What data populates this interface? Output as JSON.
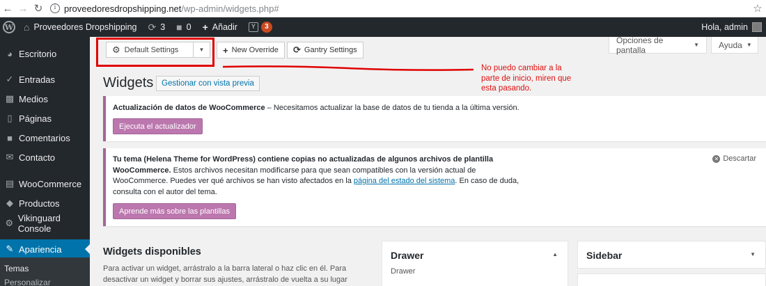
{
  "browser": {
    "back_icon": "arrow-left-icon",
    "forward_icon": "arrow-right-icon",
    "reload_icon": "reload-icon",
    "info_glyph": "i",
    "url_host": "proveedoresdropshipping.net",
    "url_path": "/wp-admin/widgets.php#"
  },
  "adminbar": {
    "site_name": "Proveedores Dropshipping",
    "updates_count": "3",
    "comments_count": "0",
    "add_new_label": "Añadir",
    "yoast_count": "3",
    "greeting": "Hola, admin"
  },
  "sidebar": {
    "items": [
      {
        "label": "Escritorio",
        "icon": "dashboard-icon"
      },
      {
        "label": "Entradas",
        "icon": "pin-icon"
      },
      {
        "label": "Medios",
        "icon": "media-icon"
      },
      {
        "label": "Páginas",
        "icon": "pages-icon"
      },
      {
        "label": "Comentarios",
        "icon": "comments-icon"
      },
      {
        "label": "Contacto",
        "icon": "mail-icon"
      },
      {
        "label": "WooCommerce",
        "icon": "woo-icon"
      },
      {
        "label": "Productos",
        "icon": "box-icon"
      },
      {
        "label": "Vikinguard Console",
        "icon": "gear-icon"
      },
      {
        "label": "Apariencia",
        "icon": "brush-icon"
      }
    ],
    "sub_items": [
      "Temas",
      "Personalizar"
    ]
  },
  "gantry": {
    "outline_select": "Default Settings",
    "new_override": "New Override",
    "gantry_settings": "Gantry Settings"
  },
  "screen_options": {
    "screen_label": "Opciones de pantalla",
    "help_label": "Ayuda"
  },
  "annotation": {
    "text": "No puedo cambiar a la parte de inicio, miren que esta pasando.",
    "color": "#e01010"
  },
  "header": {
    "title": "Widgets",
    "manage_label": "Gestionar con vista previa"
  },
  "notices": {
    "woo_update": {
      "bold": "Actualización de datos de WooCommerce",
      "text": " – Necesitamos actualizar la base de datos de tu tienda a la última versión.",
      "button": "Ejecuta el actualizador"
    },
    "theme_copies": {
      "bold": "Tu tema (Helena Theme for WordPress) contiene copias no actualizadas de algunos archivos de plantilla WooCommerce.",
      "text_a": " Estos archivos necesitan modificarse para que sean compatibles con la versión actual de WooCommerce. Puedes ver qué archivos se han visto afectados en la ",
      "link": "página del estado del sistema",
      "text_b": ". En caso de duda, consulta con el autor del tema.",
      "button": "Aprende más sobre las plantillas",
      "dismiss": "Descartar"
    }
  },
  "widgets": {
    "available_title": "Widgets disponibles",
    "available_desc": "Para activar un widget, arrástralo a la barra lateral o haz clic en él. Para desactivar un widget y borrar sus ajustes, arrástralo de vuelta a su lugar de",
    "areas": [
      {
        "title": "Drawer",
        "desc": "Drawer"
      },
      {
        "title": "Sidebar",
        "desc": ""
      }
    ]
  },
  "colors": {
    "admin_bar": "#23282d",
    "accent": "#0073aa",
    "woo_button": "#bb77ae",
    "highlight_box": "#e00000"
  }
}
